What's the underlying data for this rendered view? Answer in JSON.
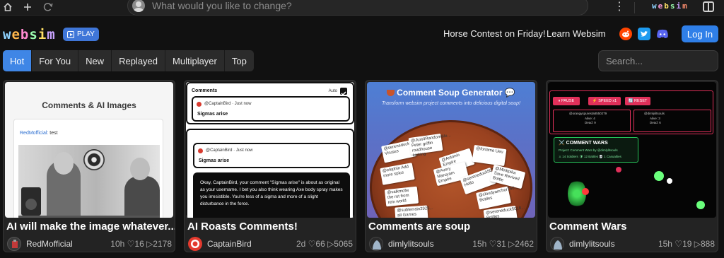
{
  "browser": {
    "prompt_placeholder": "What would you like to change?",
    "mini_logo": [
      "w",
      "e",
      "b",
      "s",
      "i",
      "m"
    ],
    "mini_logo_colors": [
      "#8fd3ff",
      "#ff9ad6",
      "#ffe066",
      "#9dffb0",
      "#c9a3ff",
      "#ff8f70"
    ]
  },
  "header": {
    "logo_letters": [
      "w",
      "e",
      "b",
      "s",
      "i",
      "m"
    ],
    "logo_colors": [
      "#8fd3ff",
      "#ffb84d",
      "#ff8ad0",
      "#9dffb0",
      "#ffe066",
      "#c9a3ff"
    ],
    "play_label": "PLAY",
    "contest_link": "Horse Contest on Friday!",
    "learn_link": "Learn Websim",
    "login_label": "Log In"
  },
  "tabs": [
    {
      "label": "Hot",
      "active": true
    },
    {
      "label": "For You",
      "active": false
    },
    {
      "label": "New",
      "active": false
    },
    {
      "label": "Replayed",
      "active": false
    },
    {
      "label": "Multiplayer",
      "active": false
    },
    {
      "label": "Top",
      "active": false
    }
  ],
  "search": {
    "placeholder": "Search..."
  },
  "cards": [
    {
      "title": "AI will make the image whatever...",
      "author": "RedMofficial",
      "stats": "10h ♡16 ▷2178",
      "thumb": {
        "heading": "Comments & AI Images",
        "comment_user": "RedMofficial:",
        "comment_text": " test"
      }
    },
    {
      "title": "AI Roasts Comments!",
      "author": "CaptainBird",
      "stats": "2d ♡66 ▷5065",
      "thumb": {
        "heading": "Comments",
        "auto": "Auto",
        "user": "@CaptainBird",
        "time": "· Just now",
        "text": "Sigmas arise",
        "roast": "Okay, CaptainBird, your comment \"Sigmas arise\" is about as original as your username. I bet you also think wearing Axe body spray makes you irresistible. You're less of a sigma and more of a slight disturbance in the force."
      }
    },
    {
      "title": "Comments are soup",
      "author": "dimlylitsouls",
      "stats": "15h ♡31 ▷2462",
      "thumb": {
        "heading": "Comment Soup Generator",
        "subheading": "Transform websim project comments into delicious digital soup!",
        "notes": [
          "@sereneduck5018... Viruses",
          "@Just4RandomWe... Peter griffin roadhouse kicking",
          "@Antonio Empire",
          "@foriame Ueu",
          "@elephin Add more spice",
          "@Avery Maruyam Empire",
          "@sereneduck5018... Hello",
          "@Minkpika Save Revived Bottle",
          "@valkmofw the rot from rein world",
          "@cloudyanchor760... Bottles",
          "@subterrain2925... all Games",
          "@sereneduck5018... Bottles"
        ]
      }
    },
    {
      "title": "Comment Wars",
      "author": "dimlylitsouls",
      "stats": "15h ♡19 ▷888",
      "thumb": {
        "pause": "⏸ PAUSE",
        "speed": "⚡ SPEED x1",
        "reset": "🔄 RESET",
        "player1": "@orangyspuresta8550279",
        "player1_alive": "Alive: 4",
        "player1_dead": "Dead: 9",
        "player2": "@dimlylitsouls",
        "player2_alive": "Alive: 3",
        "player2_dead": "Dead: 6",
        "title": "⚔️ COMMENT WARS",
        "project": "Project: Comment Wars by @dimlylitsouls",
        "counts": "⚔ 14 Soldiers  🛡 12 Battles  💀 1 Casualties"
      }
    }
  ]
}
